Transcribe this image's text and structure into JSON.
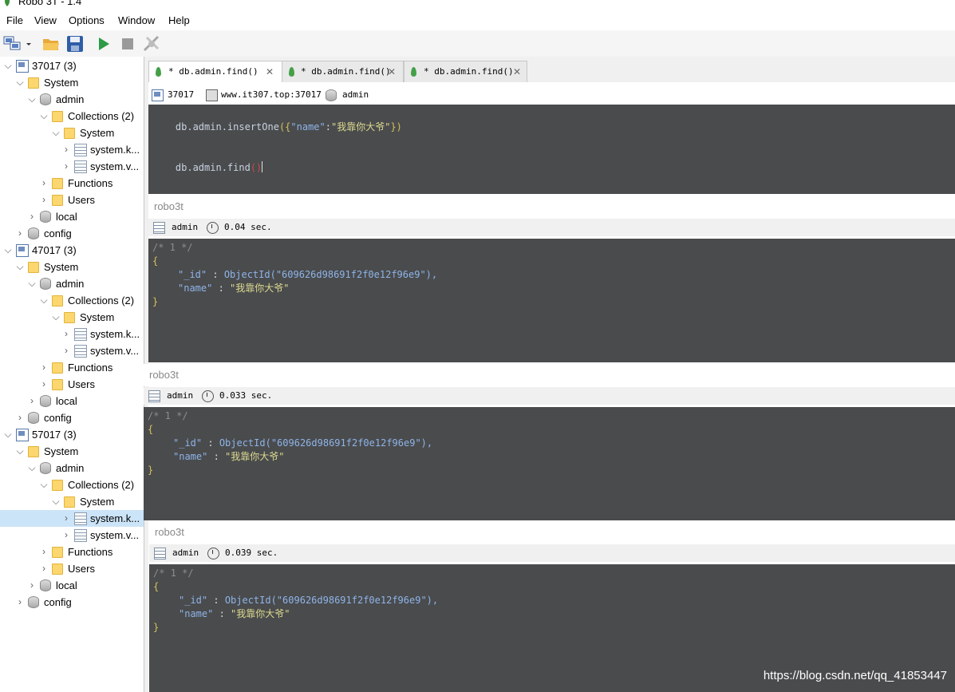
{
  "window": {
    "title": "Robo 3T - 1.4"
  },
  "menu": [
    "File",
    "View",
    "Options",
    "Window",
    "Help"
  ],
  "toolbar": {
    "buttons": [
      "connect-icon",
      "open-icon",
      "save-icon",
      "execute-icon",
      "stop-icon",
      "format-icon"
    ]
  },
  "sidebar": {
    "rows": [
      {
        "label": "37017 (3)",
        "type": "server",
        "level": 0,
        "open": true
      },
      {
        "label": "System",
        "type": "folder",
        "level": 1,
        "open": true
      },
      {
        "label": "admin",
        "type": "db",
        "level": 2,
        "open": true
      },
      {
        "label": "Collections (2)",
        "type": "folder",
        "level": 3,
        "open": true
      },
      {
        "label": "System",
        "type": "folder",
        "level": 4,
        "open": true
      },
      {
        "label": "system.k...",
        "type": "collection",
        "level": 5,
        "open": false
      },
      {
        "label": "system.v...",
        "type": "collection",
        "level": 5,
        "open": false
      },
      {
        "label": "Functions",
        "type": "folder",
        "level": 3,
        "open": false
      },
      {
        "label": "Users",
        "type": "folder",
        "level": 3,
        "open": false
      },
      {
        "label": "local",
        "type": "db",
        "level": 2,
        "open": false
      },
      {
        "label": "config",
        "type": "db",
        "level": 1,
        "open": false
      },
      {
        "label": "47017 (3)",
        "type": "server",
        "level": 0,
        "open": true
      },
      {
        "label": "System",
        "type": "folder",
        "level": 1,
        "open": true
      },
      {
        "label": "admin",
        "type": "db",
        "level": 2,
        "open": true
      },
      {
        "label": "Collections (2)",
        "type": "folder",
        "level": 3,
        "open": true
      },
      {
        "label": "System",
        "type": "folder",
        "level": 4,
        "open": true
      },
      {
        "label": "system.k...",
        "type": "collection",
        "level": 5,
        "open": false
      },
      {
        "label": "system.v...",
        "type": "collection",
        "level": 5,
        "open": false
      },
      {
        "label": "Functions",
        "type": "folder",
        "level": 3,
        "open": false
      },
      {
        "label": "Users",
        "type": "folder",
        "level": 3,
        "open": false
      },
      {
        "label": "local",
        "type": "db",
        "level": 2,
        "open": false
      },
      {
        "label": "config",
        "type": "db",
        "level": 1,
        "open": false
      },
      {
        "label": "57017 (3)",
        "type": "server",
        "level": 0,
        "open": true
      },
      {
        "label": "System",
        "type": "folder",
        "level": 1,
        "open": true
      },
      {
        "label": "admin",
        "type": "db",
        "level": 2,
        "open": true
      },
      {
        "label": "Collections (2)",
        "type": "folder",
        "level": 3,
        "open": true
      },
      {
        "label": "System",
        "type": "folder",
        "level": 4,
        "open": true
      },
      {
        "label": "system.k...",
        "type": "collection",
        "level": 5,
        "open": false,
        "selected": true
      },
      {
        "label": "system.v...",
        "type": "collection",
        "level": 5,
        "open": false
      },
      {
        "label": "Functions",
        "type": "folder",
        "level": 3,
        "open": false
      },
      {
        "label": "Users",
        "type": "folder",
        "level": 3,
        "open": false
      },
      {
        "label": "local",
        "type": "db",
        "level": 2,
        "open": false
      },
      {
        "label": "config",
        "type": "db",
        "level": 1,
        "open": false
      }
    ]
  },
  "tabs": [
    {
      "label": "*   db.admin.find()"
    },
    {
      "label": "* db.admin.find()"
    },
    {
      "label": "* db.admin.find()"
    }
  ],
  "query_bar": {
    "port": "37017",
    "host": "www.it307.top:37017",
    "db": "admin"
  },
  "editor": {
    "line1_obj": "db.admin.insertOne",
    "line1_open": "({",
    "line1_key": "\"name\"",
    "line1_colon": ":",
    "line1_val": "\"我靠你大爷\"",
    "line1_close": "})",
    "line3_obj": "db.admin.find",
    "line3_parens": "()"
  },
  "results": [
    {
      "label": "robo3t",
      "db": "admin",
      "time": "0.04 sec.",
      "comment": "/* 1 */",
      "open": "{",
      "id_key": "\"_id\"",
      "id_sep": " : ",
      "id_val": "ObjectId(\"609626d98691f2f0e12f96e9\"),",
      "name_key": "\"name\"",
      "name_sep": " : ",
      "name_val": "\"我靠你大爷\"",
      "close": "}"
    },
    {
      "label": "robo3t",
      "db": "admin",
      "time": "0.033 sec.",
      "comment": "/* 1 */",
      "open": "{",
      "id_key": "\"_id\"",
      "id_sep": " : ",
      "id_val": "ObjectId(\"609626d98691f2f0e12f96e9\"),",
      "name_key": "\"name\"",
      "name_sep": " : ",
      "name_val": "\"我靠你大爷\"",
      "close": "}"
    },
    {
      "label": "robo3t",
      "db": "admin",
      "time": "0.039 sec.",
      "comment": "/* 1 */",
      "open": "{",
      "id_key": "\"_id\"",
      "id_sep": " : ",
      "id_val": "ObjectId(\"609626d98691f2f0e12f96e9\"),",
      "name_key": "\"name\"",
      "name_sep": " : ",
      "name_val": "\"我靠你大爷\"",
      "close": "}"
    }
  ],
  "watermark": "https://blog.csdn.net/qq_41853447"
}
